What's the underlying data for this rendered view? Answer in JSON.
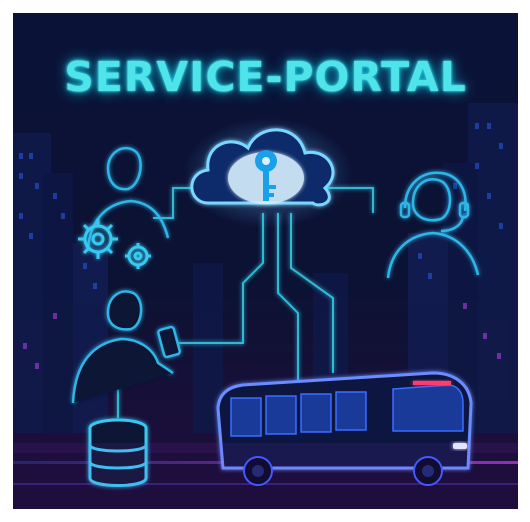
{
  "title": "SERVICE-PORTAL",
  "colors": {
    "background": "#0b1030",
    "cyan_glow": "#4fe3ea",
    "blue_glow": "#2a8cff",
    "magenta_glow": "#d24bff",
    "bus_light": "#ff3d6e"
  },
  "icons": [
    "cloud-key-icon",
    "gears-icon",
    "person-icon",
    "headset-agent-icon",
    "person-with-phone-icon",
    "database-icon",
    "bus-icon",
    "city-skyline"
  ]
}
